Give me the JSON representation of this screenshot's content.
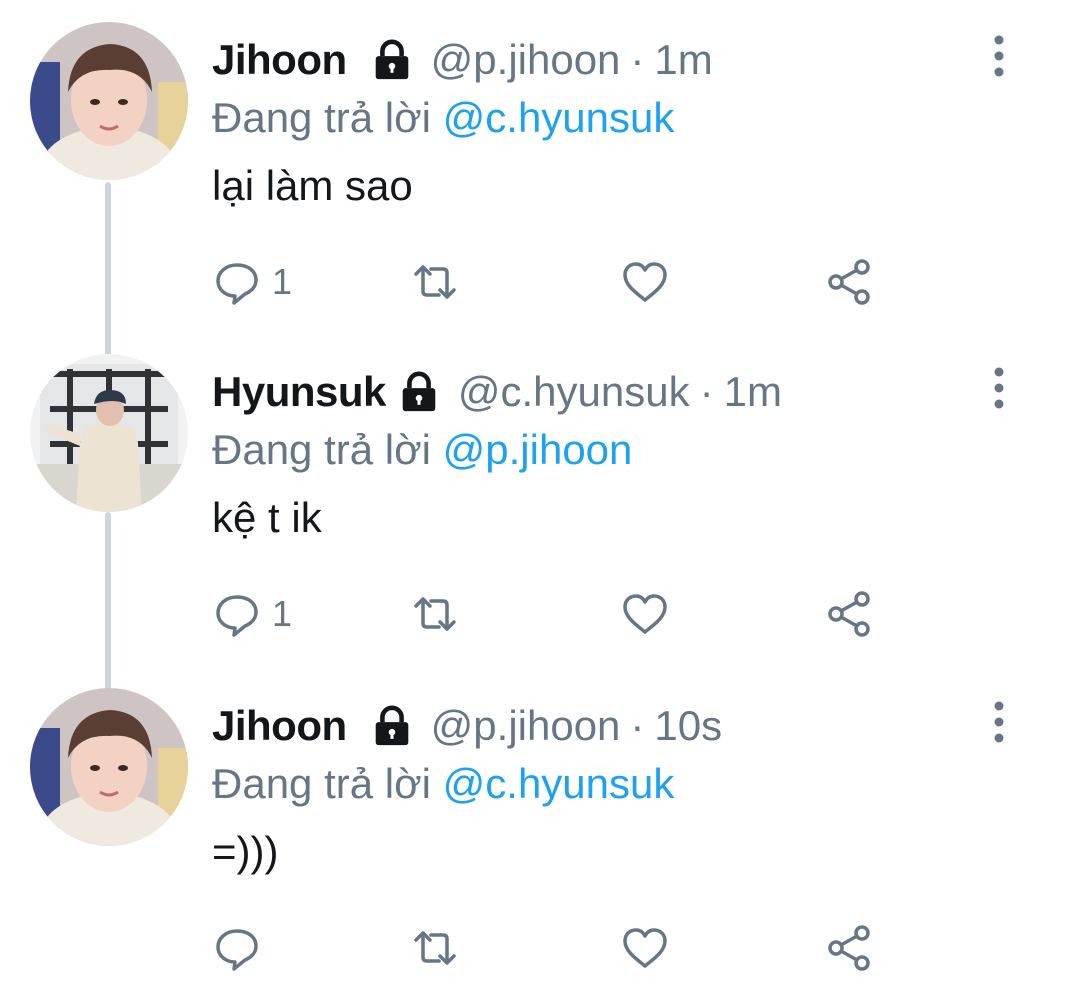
{
  "thread": {
    "tweets": [
      {
        "name": "Jihoon",
        "handle": "@p.jihoon",
        "separator": "·",
        "time": "1m",
        "reply_prefix": "Đang trả lời",
        "reply_to": "@c.hyunsuk",
        "text": "lại làm sao",
        "reply_count": "1",
        "locked": true,
        "icons": [
          "lock-icon",
          "more-icon",
          "reply-icon",
          "retweet-icon",
          "like-icon",
          "share-icon"
        ]
      },
      {
        "name": "Hyunsuk",
        "handle": "@c.hyunsuk",
        "separator": "·",
        "time": "1m",
        "reply_prefix": "Đang trả lời",
        "reply_to": "@p.jihoon",
        "text": "kệ t ik",
        "reply_count": "1",
        "locked": true,
        "icons": [
          "lock-icon",
          "more-icon",
          "reply-icon",
          "retweet-icon",
          "like-icon",
          "share-icon"
        ]
      },
      {
        "name": "Jihoon",
        "handle": "@p.jihoon",
        "separator": "·",
        "time": "10s",
        "reply_prefix": "Đang trả lời",
        "reply_to": "@c.hyunsuk",
        "text": "=)))",
        "reply_count": "",
        "locked": true,
        "icons": [
          "lock-icon",
          "more-icon",
          "reply-icon",
          "retweet-icon",
          "like-icon",
          "share-icon"
        ]
      }
    ]
  },
  "colors": {
    "text_primary": "#14171a",
    "text_secondary": "#657786",
    "mention": "#1da1f2",
    "thread_line": "#ccd6dd"
  }
}
